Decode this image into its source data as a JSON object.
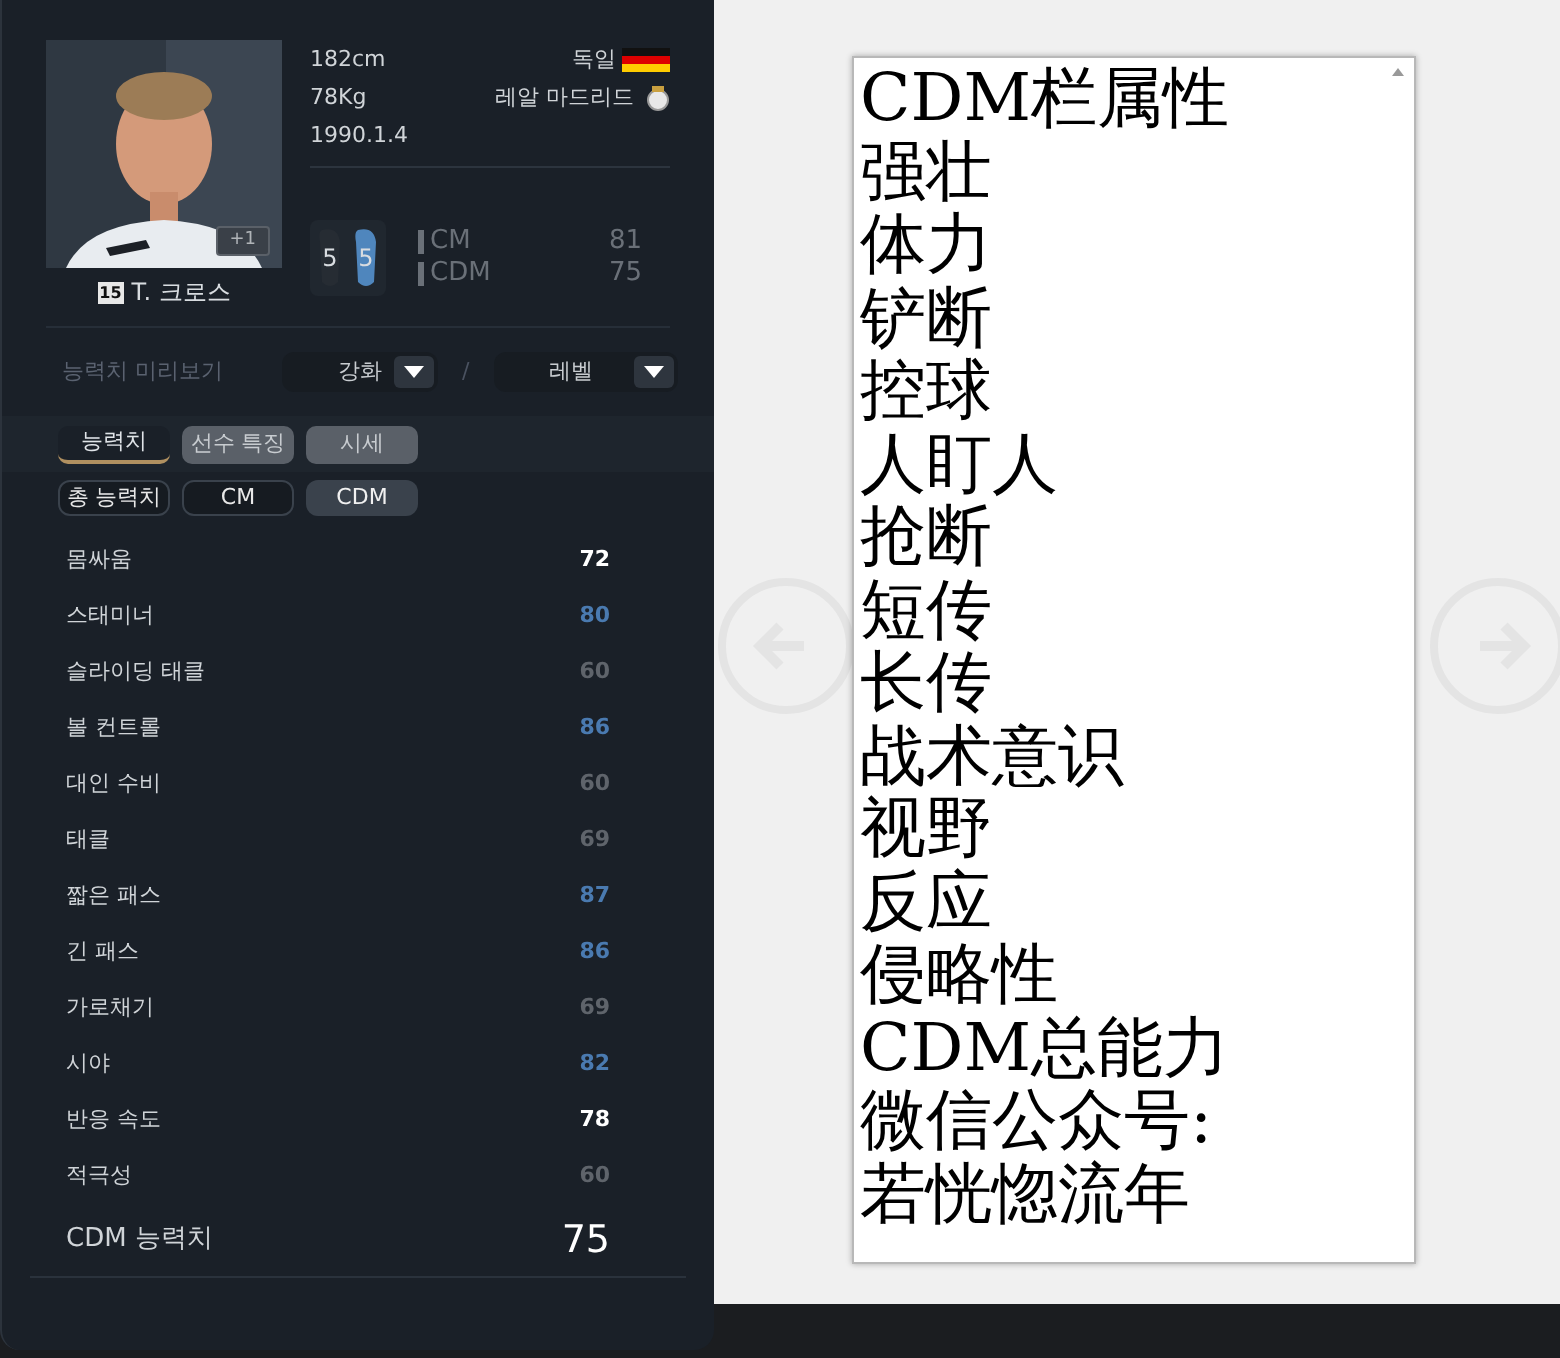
{
  "player": {
    "height": "182cm",
    "weight": "78Kg",
    "birth": "1990.1.4",
    "nation": "독일",
    "club": "레알 마드리드",
    "upgrade": "+1",
    "number": "15",
    "name": "T. 크로스",
    "feet": [
      {
        "value": "5",
        "kind": "left"
      },
      {
        "value": "5",
        "kind": "right"
      }
    ],
    "positions": [
      {
        "name": "CM",
        "rating": "81"
      },
      {
        "name": "CDM",
        "rating": "75"
      }
    ]
  },
  "preview": {
    "label": "능력치 미리보기",
    "enhance": "강화",
    "separator": "/",
    "level": "레벨"
  },
  "tabs": [
    {
      "label": "능력치",
      "selected": true
    },
    {
      "label": "선수 특징",
      "selected": false
    },
    {
      "label": "시세",
      "selected": false
    }
  ],
  "subtabs": [
    {
      "label": "총 능력치",
      "selected": false
    },
    {
      "label": "CM",
      "selected": false
    },
    {
      "label": "CDM",
      "selected": true
    }
  ],
  "stats": [
    {
      "name": "몸싸움",
      "value": "72",
      "color": "#ffffff"
    },
    {
      "name": "스태미너",
      "value": "80",
      "color": "#4a7ab0"
    },
    {
      "name": "슬라이딩 태클",
      "value": "60",
      "color": "#5f646b"
    },
    {
      "name": "볼 컨트롤",
      "value": "86",
      "color": "#4a7ab0"
    },
    {
      "name": "대인 수비",
      "value": "60",
      "color": "#5f646b"
    },
    {
      "name": "태클",
      "value": "69",
      "color": "#5f646b"
    },
    {
      "name": "짧은 패스",
      "value": "87",
      "color": "#4a7ab0"
    },
    {
      "name": "긴 패스",
      "value": "86",
      "color": "#4a7ab0"
    },
    {
      "name": "가로채기",
      "value": "69",
      "color": "#5f646b"
    },
    {
      "name": "시야",
      "value": "82",
      "color": "#4a7ab0"
    },
    {
      "name": "반응 속도",
      "value": "78",
      "color": "#ffffff"
    },
    {
      "name": "적극성",
      "value": "60",
      "color": "#5f646b"
    }
  ],
  "total": {
    "label": "CDM 능력치",
    "value": "75"
  },
  "note": {
    "lines": [
      "CDM栏属性",
      "强壮",
      "体力",
      "铲断",
      "控球",
      "人盯人",
      "抢断",
      "短传",
      "长传",
      "战术意识",
      "视野",
      "反应",
      "侵略性",
      "CDM总能力",
      "微信公众号:",
      "若恍惚流年"
    ]
  }
}
